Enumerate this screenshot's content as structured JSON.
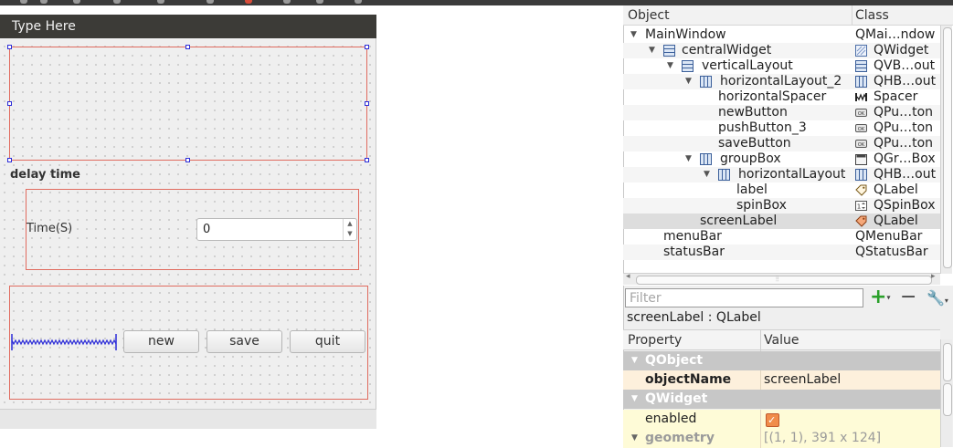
{
  "form": {
    "menu_placeholder": "Type Here",
    "group_title": "delay time",
    "time_label": "Time(S)",
    "spin_value": "0",
    "buttons": {
      "new": "new",
      "save": "save",
      "quit": "quit"
    }
  },
  "object_inspector": {
    "col_object": "Object",
    "col_class": "Class",
    "rows": [
      {
        "object": "MainWindow",
        "class": "QMai…ndow"
      },
      {
        "object": "centralWidget",
        "class": "QWidget"
      },
      {
        "object": "verticalLayout",
        "class": "QVB…out"
      },
      {
        "object": "horizontalLayout_2",
        "class": "QHB…out"
      },
      {
        "object": "horizontalSpacer",
        "class": "Spacer"
      },
      {
        "object": "newButton",
        "class": "QPu…ton"
      },
      {
        "object": "pushButton_3",
        "class": "QPu…ton"
      },
      {
        "object": "saveButton",
        "class": "QPu…ton"
      },
      {
        "object": "groupBox",
        "class": "QGr…Box"
      },
      {
        "object": "horizontalLayout",
        "class": "QHB…out"
      },
      {
        "object": "label",
        "class": "QLabel"
      },
      {
        "object": "spinBox",
        "class": "QSpinBox"
      },
      {
        "object": "screenLabel",
        "class": "QLabel"
      },
      {
        "object": "menuBar",
        "class": "QMenuBar"
      },
      {
        "object": "statusBar",
        "class": "QStatusBar"
      }
    ]
  },
  "property_editor": {
    "filter_placeholder": "Filter",
    "selected_caption": "screenLabel : QLabel",
    "col_property": "Property",
    "col_value": "Value",
    "groups": {
      "qobject": "QObject",
      "qwidget": "QWidget"
    },
    "rows": {
      "objectName": {
        "name": "objectName",
        "value": "screenLabel"
      },
      "enabled": {
        "name": "enabled",
        "value": true
      },
      "geometry": {
        "name": "geometry",
        "value": "[(1, 1), 391 x 124]"
      }
    }
  },
  "colors": {
    "selection_red": "#e06b5f",
    "handle_blue": "#2b2bd8",
    "add_green": "#2aa02a"
  }
}
